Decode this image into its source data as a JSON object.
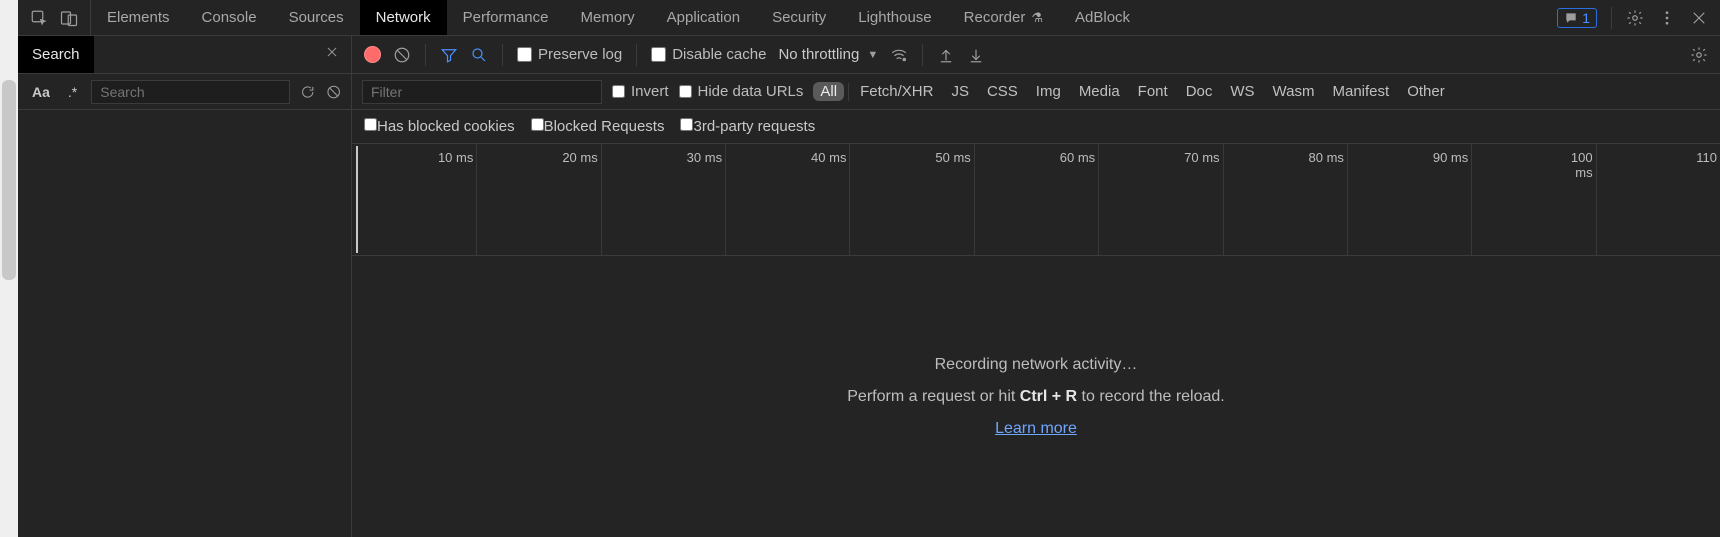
{
  "tabs": {
    "items": [
      "Elements",
      "Console",
      "Sources",
      "Network",
      "Performance",
      "Memory",
      "Application",
      "Security",
      "Lighthouse",
      "Recorder",
      "AdBlock"
    ],
    "active": "Network",
    "messages_count": "1"
  },
  "searchPanel": {
    "title": "Search",
    "matchCase": "Aa",
    "regex": ".*",
    "placeholder": "Search"
  },
  "toolbar": {
    "preserve_log": "Preserve log",
    "disable_cache": "Disable cache",
    "throttle": "No throttling"
  },
  "filter": {
    "placeholder": "Filter",
    "invert": "Invert",
    "hide_data_urls": "Hide data URLs",
    "types": [
      "All",
      "Fetch/XHR",
      "JS",
      "CSS",
      "Img",
      "Media",
      "Font",
      "Doc",
      "WS",
      "Wasm",
      "Manifest",
      "Other"
    ],
    "type_active": "All"
  },
  "filter2": {
    "blocked_cookies": "Has blocked cookies",
    "blocked_requests": "Blocked Requests",
    "third_party": "3rd-party requests"
  },
  "timeline": {
    "ticks": [
      "10 ms",
      "20 ms",
      "30 ms",
      "40 ms",
      "50 ms",
      "60 ms",
      "70 ms",
      "80 ms",
      "90 ms",
      "100 ms",
      "110"
    ]
  },
  "empty": {
    "line1": "Recording network activity…",
    "pre": "Perform a request or hit ",
    "kbd": "Ctrl + R",
    "post": " to record the reload.",
    "learn": "Learn more"
  }
}
